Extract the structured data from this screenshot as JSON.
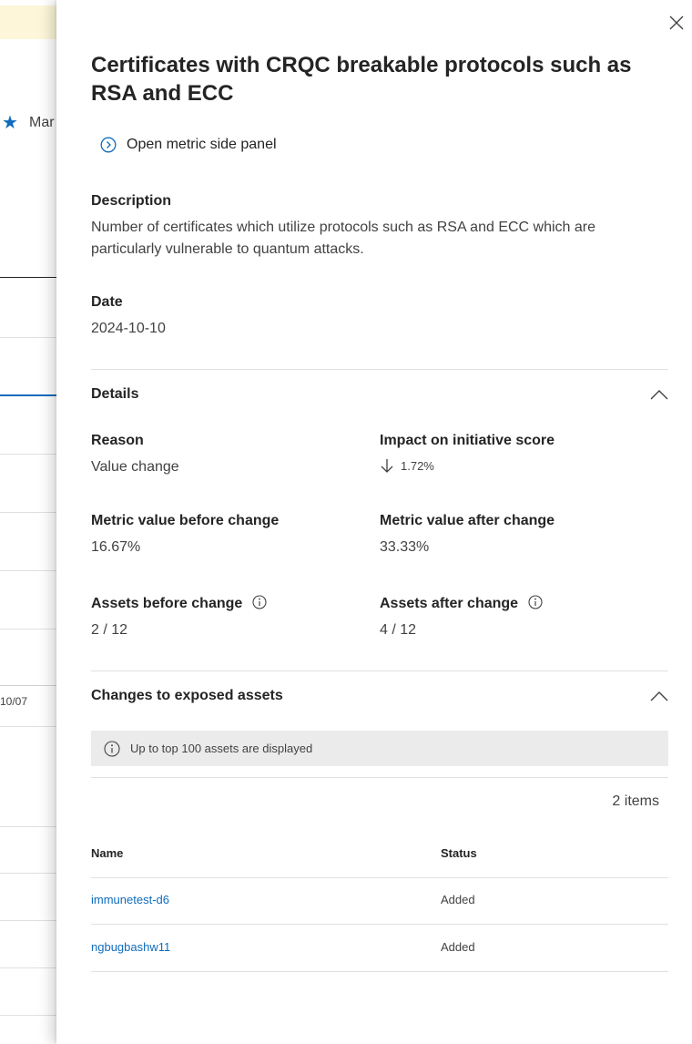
{
  "background": {
    "mark_label": "Mar",
    "axis_date": "10/07"
  },
  "panel": {
    "title": "Certificates with CRQC breakable protocols such as RSA and ECC",
    "open_link_label": "Open metric side panel",
    "description": {
      "label": "Description",
      "text": "Number of certificates which utilize protocols such as RSA and ECC which are particularly vulnerable to quantum attacks."
    },
    "date": {
      "label": "Date",
      "value": "2024-10-10"
    },
    "details": {
      "heading": "Details",
      "reason_label": "Reason",
      "reason_value": "Value change",
      "impact_label": "Impact on initiative score",
      "impact_value": "1.72%",
      "metric_before_label": "Metric value before change",
      "metric_before_value": "16.67%",
      "metric_after_label": "Metric value after change",
      "metric_after_value": "33.33%",
      "assets_before_label": "Assets before change",
      "assets_before_value": "2 / 12",
      "assets_after_label": "Assets after change",
      "assets_after_value": "4 / 12"
    },
    "changes": {
      "heading": "Changes to exposed assets",
      "info_text": "Up to top 100 assets are displayed",
      "items_count": "2 items",
      "columns": [
        "Name",
        "Status"
      ],
      "rows": [
        {
          "name": "immunetest-d6",
          "status": "Added"
        },
        {
          "name": "ngbugbashw11",
          "status": "Added"
        }
      ]
    }
  },
  "colors": {
    "accent": "#0f6cbd",
    "banner": "#fdf6d8",
    "info_bar": "#ebebeb",
    "divider": "#e0e0e0"
  },
  "icons": {
    "close": "close-icon",
    "open_panel": "chevron-right-circle-icon",
    "collapse": "chevron-up-icon",
    "info": "info-icon",
    "arrow_down": "arrow-down-icon",
    "star": "star-icon"
  }
}
